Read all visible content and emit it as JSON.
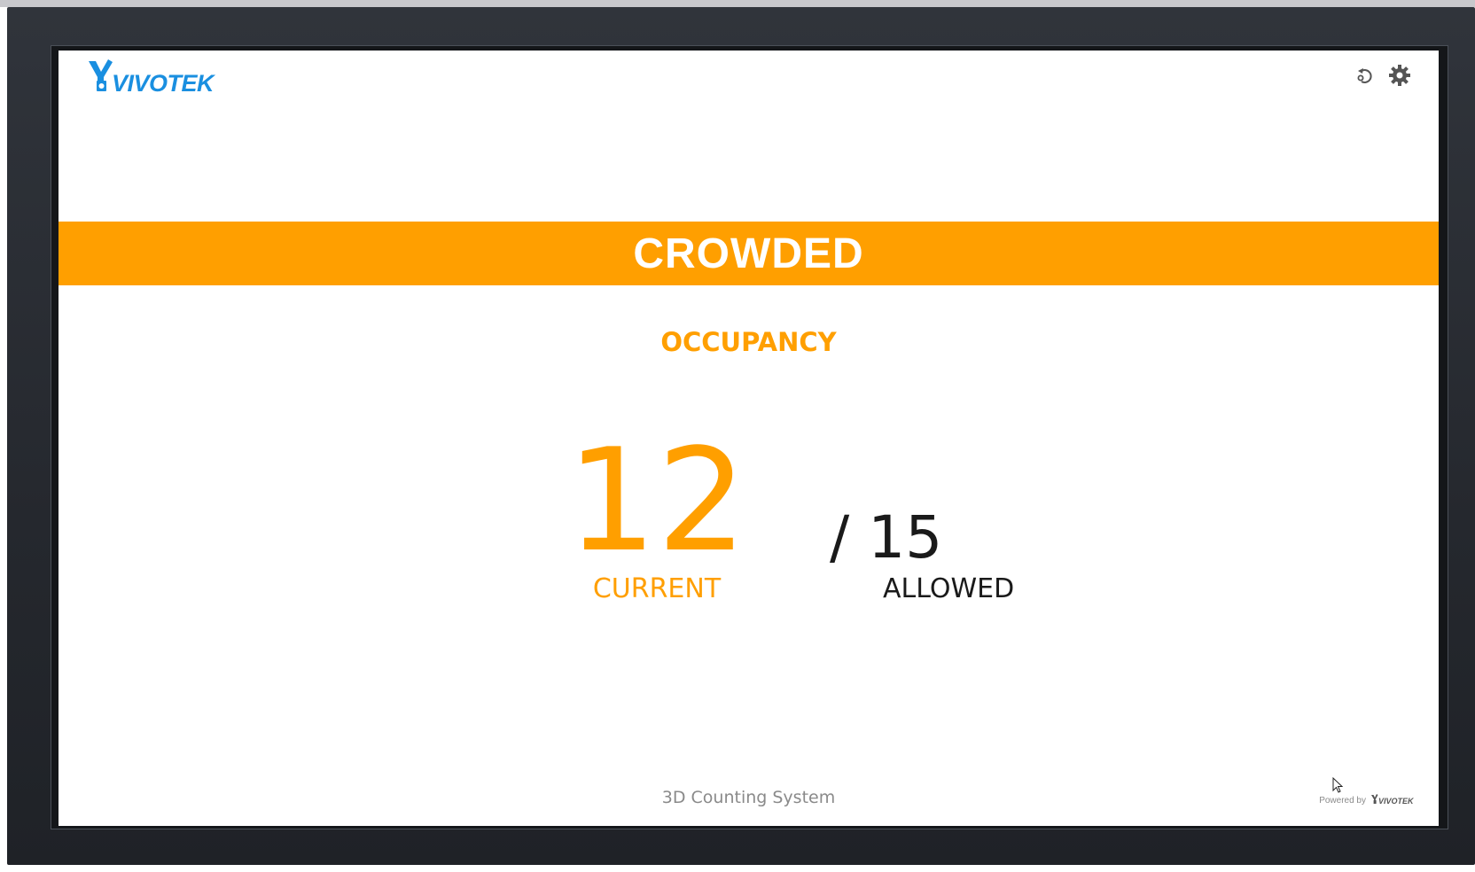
{
  "brand": {
    "logo_text": "VIVOTEK",
    "logo_color": "#1a8fe0"
  },
  "header_icons": {
    "refresh_icon": "refresh-icon",
    "settings_icon": "gear-icon"
  },
  "status": {
    "label": "CROWDED",
    "color": "#ff9f00"
  },
  "occupancy": {
    "title": "OCCUPANCY",
    "current_value": "12",
    "current_label": "CURRENT",
    "allowed_value": "/ 15",
    "allowed_label": "ALLOWED",
    "accent_color": "#ff9f00",
    "allowed_color": "#1a1a1a"
  },
  "footer": {
    "system_name": "3D Counting System",
    "powered_by": "Powered by",
    "powered_logo_text": "VIVOTEK"
  }
}
